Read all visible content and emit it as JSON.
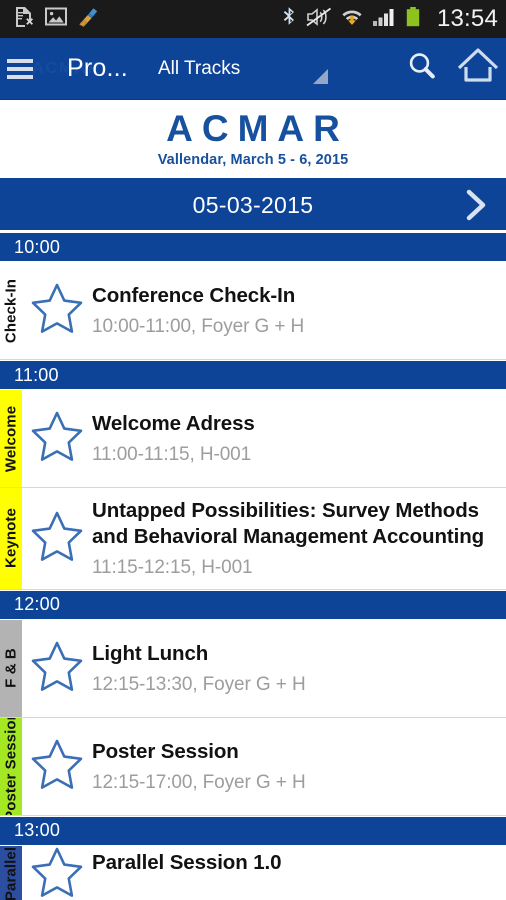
{
  "statusbar": {
    "clock": "13:54",
    "left_icons": [
      "sim-card-error-icon",
      "image-icon",
      "broom-icon"
    ],
    "right_icons": [
      "bluetooth-icon",
      "sound-mute-vibrate-off-icon",
      "wifi-download-icon",
      "cellular-signal-icon",
      "battery-icon"
    ]
  },
  "actionbar": {
    "menu_icon": "hamburger-menu-icon",
    "watermark": "ACMAR",
    "title": "Pro...",
    "spinner_value": "All Tracks",
    "search_icon": "search-icon",
    "home_icon": "home-icon"
  },
  "logo": {
    "name": "ACMAR",
    "subtitle": "Vallendar, March 5 - 6, 2015"
  },
  "datebar": {
    "date": "05-03-2015",
    "next_icon": "chevron-right-icon"
  },
  "colors": {
    "brand_blue": "#0d4498",
    "logo_blue": "#17509e",
    "track_welcome": "#ffff00",
    "track_keynote": "#ffff00",
    "track_fb": "#b3b3b3",
    "track_poster": "#a4e824",
    "track_parallel": "#2b4ea0",
    "track_checkin": "#ffffff",
    "star_outline": "#3a6fb5",
    "meta_gray": "#9d9d9d"
  },
  "schedule": [
    {
      "time_header": "10:00",
      "sessions": [
        {
          "track": "Check-In",
          "track_color": "#ffffff",
          "title": "Conference Check-In",
          "meta": "10:00-11:00, Foyer G + H",
          "favorite_icon": "star-outline-icon"
        }
      ]
    },
    {
      "time_header": "11:00",
      "sessions": [
        {
          "track": "Welcome",
          "track_color": "#ffff00",
          "title": "Welcome Adress",
          "meta": "11:00-11:15, H-001",
          "favorite_icon": "star-outline-icon"
        },
        {
          "track": "Keynote",
          "track_color": "#ffff00",
          "title": "Untapped Possibilities: Survey Methods and Behavioral Management Accounting",
          "meta": "11:15-12:15, H-001",
          "favorite_icon": "star-outline-icon"
        }
      ]
    },
    {
      "time_header": "12:00",
      "sessions": [
        {
          "track": "F & B",
          "track_color": "#b3b3b3",
          "title": "Light Lunch",
          "meta": "12:15-13:30, Foyer G + H",
          "favorite_icon": "star-outline-icon"
        },
        {
          "track": "Poster Session",
          "track_color": "#a4e824",
          "title": "Poster Session",
          "meta": "12:15-17:00, Foyer G + H",
          "favorite_icon": "star-outline-icon"
        }
      ]
    },
    {
      "time_header": "13:00",
      "sessions": [
        {
          "track": "Parallel",
          "track_color": "#2b4ea0",
          "title": "Parallel Session 1.0",
          "meta": "",
          "favorite_icon": "star-outline-icon",
          "partial": true
        }
      ]
    }
  ]
}
